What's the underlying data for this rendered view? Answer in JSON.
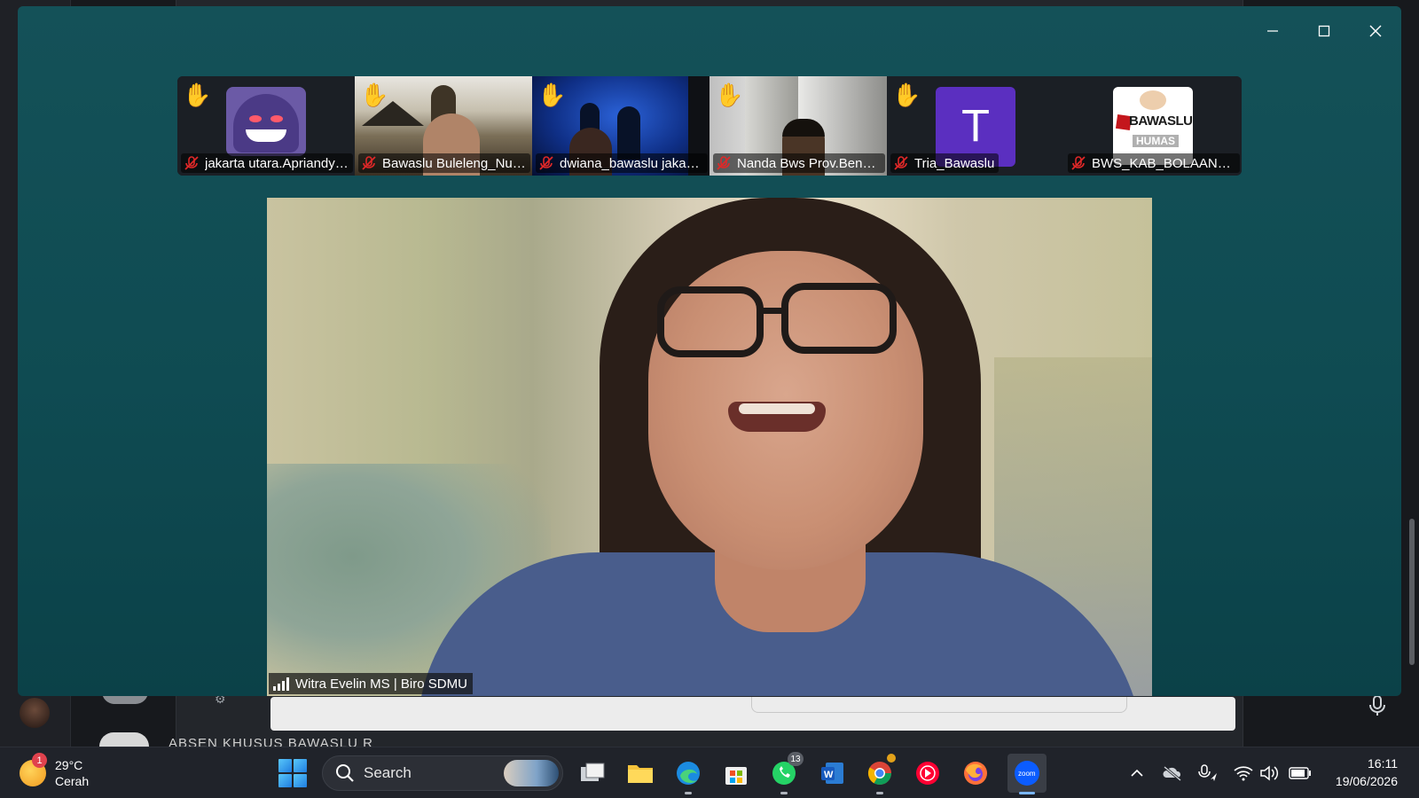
{
  "zoom": {
    "window_controls": {
      "minimize": "minimize-icon",
      "maximize": "maximize-icon",
      "close": "close-icon"
    },
    "participants": [
      {
        "name": "jakarta utara.Apriandy ...",
        "hand_raised": true,
        "muted": true,
        "icon": "hand-raised-icon"
      },
      {
        "name": "Bawaslu Buleleng_Nua...",
        "hand_raised": true,
        "muted": true,
        "icon": "hand-raised-icon"
      },
      {
        "name": "dwiana_bawaslu jakart...",
        "hand_raised": true,
        "muted": true,
        "icon": "hand-raised-icon"
      },
      {
        "name": "Nanda Bws Prov.Beng...",
        "hand_raised": true,
        "muted": true,
        "icon": "hand-raised-icon"
      },
      {
        "name": "Tria_Bawaslu",
        "hand_raised": true,
        "muted": true,
        "icon": "hand-raised-icon",
        "avatar_letter": "T",
        "avatar_color": "#5b2fc0"
      },
      {
        "name": "BWS_KAB_BOLAANG ...",
        "hand_raised": false,
        "muted": true,
        "logo_text": "BAWASLU",
        "logo_subtext": "HUMAS"
      }
    ],
    "hand_glyph": "✋",
    "active_speaker": {
      "name": "Witra Evelin MS | Biro SDMU"
    }
  },
  "background_app": {
    "list_text": "ABSEN KHUSUS BAWASLU R"
  },
  "taskbar": {
    "weather": {
      "badge": "1",
      "temp": "29°C",
      "condition": "Cerah"
    },
    "search_label": "Search",
    "apps": [
      {
        "name": "task-view"
      },
      {
        "name": "file-explorer"
      },
      {
        "name": "edge"
      },
      {
        "name": "microsoft-store"
      },
      {
        "name": "whatsapp",
        "badge": "13"
      },
      {
        "name": "word"
      },
      {
        "name": "chrome"
      },
      {
        "name": "youtube-music"
      },
      {
        "name": "firefox"
      },
      {
        "name": "zoom",
        "label": "zoom"
      }
    ],
    "clock": {
      "time": "16:11",
      "date": "19/06/2026"
    }
  }
}
